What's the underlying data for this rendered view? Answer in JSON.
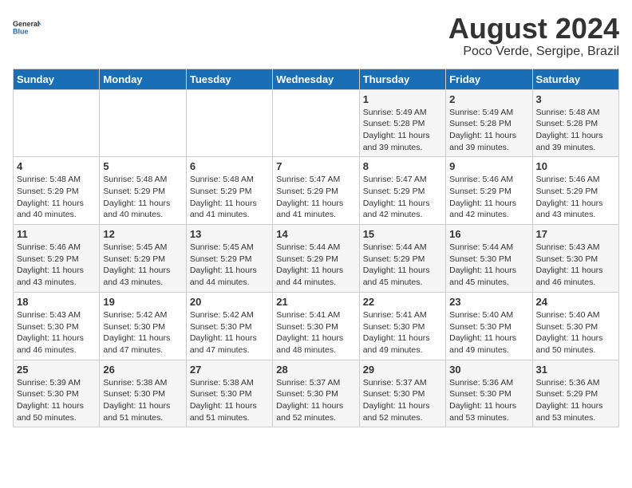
{
  "logo": {
    "line1": "General",
    "line2": "Blue"
  },
  "title": "August 2024",
  "subtitle": "Poco Verde, Sergipe, Brazil",
  "days_of_week": [
    "Sunday",
    "Monday",
    "Tuesday",
    "Wednesday",
    "Thursday",
    "Friday",
    "Saturday"
  ],
  "weeks": [
    [
      {
        "day": "",
        "info": ""
      },
      {
        "day": "",
        "info": ""
      },
      {
        "day": "",
        "info": ""
      },
      {
        "day": "",
        "info": ""
      },
      {
        "day": "1",
        "info": "Sunrise: 5:49 AM\nSunset: 5:28 PM\nDaylight: 11 hours\nand 39 minutes."
      },
      {
        "day": "2",
        "info": "Sunrise: 5:49 AM\nSunset: 5:28 PM\nDaylight: 11 hours\nand 39 minutes."
      },
      {
        "day": "3",
        "info": "Sunrise: 5:48 AM\nSunset: 5:28 PM\nDaylight: 11 hours\nand 39 minutes."
      }
    ],
    [
      {
        "day": "4",
        "info": "Sunrise: 5:48 AM\nSunset: 5:29 PM\nDaylight: 11 hours\nand 40 minutes."
      },
      {
        "day": "5",
        "info": "Sunrise: 5:48 AM\nSunset: 5:29 PM\nDaylight: 11 hours\nand 40 minutes."
      },
      {
        "day": "6",
        "info": "Sunrise: 5:48 AM\nSunset: 5:29 PM\nDaylight: 11 hours\nand 41 minutes."
      },
      {
        "day": "7",
        "info": "Sunrise: 5:47 AM\nSunset: 5:29 PM\nDaylight: 11 hours\nand 41 minutes."
      },
      {
        "day": "8",
        "info": "Sunrise: 5:47 AM\nSunset: 5:29 PM\nDaylight: 11 hours\nand 42 minutes."
      },
      {
        "day": "9",
        "info": "Sunrise: 5:46 AM\nSunset: 5:29 PM\nDaylight: 11 hours\nand 42 minutes."
      },
      {
        "day": "10",
        "info": "Sunrise: 5:46 AM\nSunset: 5:29 PM\nDaylight: 11 hours\nand 43 minutes."
      }
    ],
    [
      {
        "day": "11",
        "info": "Sunrise: 5:46 AM\nSunset: 5:29 PM\nDaylight: 11 hours\nand 43 minutes."
      },
      {
        "day": "12",
        "info": "Sunrise: 5:45 AM\nSunset: 5:29 PM\nDaylight: 11 hours\nand 43 minutes."
      },
      {
        "day": "13",
        "info": "Sunrise: 5:45 AM\nSunset: 5:29 PM\nDaylight: 11 hours\nand 44 minutes."
      },
      {
        "day": "14",
        "info": "Sunrise: 5:44 AM\nSunset: 5:29 PM\nDaylight: 11 hours\nand 44 minutes."
      },
      {
        "day": "15",
        "info": "Sunrise: 5:44 AM\nSunset: 5:29 PM\nDaylight: 11 hours\nand 45 minutes."
      },
      {
        "day": "16",
        "info": "Sunrise: 5:44 AM\nSunset: 5:30 PM\nDaylight: 11 hours\nand 45 minutes."
      },
      {
        "day": "17",
        "info": "Sunrise: 5:43 AM\nSunset: 5:30 PM\nDaylight: 11 hours\nand 46 minutes."
      }
    ],
    [
      {
        "day": "18",
        "info": "Sunrise: 5:43 AM\nSunset: 5:30 PM\nDaylight: 11 hours\nand 46 minutes."
      },
      {
        "day": "19",
        "info": "Sunrise: 5:42 AM\nSunset: 5:30 PM\nDaylight: 11 hours\nand 47 minutes."
      },
      {
        "day": "20",
        "info": "Sunrise: 5:42 AM\nSunset: 5:30 PM\nDaylight: 11 hours\nand 47 minutes."
      },
      {
        "day": "21",
        "info": "Sunrise: 5:41 AM\nSunset: 5:30 PM\nDaylight: 11 hours\nand 48 minutes."
      },
      {
        "day": "22",
        "info": "Sunrise: 5:41 AM\nSunset: 5:30 PM\nDaylight: 11 hours\nand 49 minutes."
      },
      {
        "day": "23",
        "info": "Sunrise: 5:40 AM\nSunset: 5:30 PM\nDaylight: 11 hours\nand 49 minutes."
      },
      {
        "day": "24",
        "info": "Sunrise: 5:40 AM\nSunset: 5:30 PM\nDaylight: 11 hours\nand 50 minutes."
      }
    ],
    [
      {
        "day": "25",
        "info": "Sunrise: 5:39 AM\nSunset: 5:30 PM\nDaylight: 11 hours\nand 50 minutes."
      },
      {
        "day": "26",
        "info": "Sunrise: 5:38 AM\nSunset: 5:30 PM\nDaylight: 11 hours\nand 51 minutes."
      },
      {
        "day": "27",
        "info": "Sunrise: 5:38 AM\nSunset: 5:30 PM\nDaylight: 11 hours\nand 51 minutes."
      },
      {
        "day": "28",
        "info": "Sunrise: 5:37 AM\nSunset: 5:30 PM\nDaylight: 11 hours\nand 52 minutes."
      },
      {
        "day": "29",
        "info": "Sunrise: 5:37 AM\nSunset: 5:30 PM\nDaylight: 11 hours\nand 52 minutes."
      },
      {
        "day": "30",
        "info": "Sunrise: 5:36 AM\nSunset: 5:30 PM\nDaylight: 11 hours\nand 53 minutes."
      },
      {
        "day": "31",
        "info": "Sunrise: 5:36 AM\nSunset: 5:29 PM\nDaylight: 11 hours\nand 53 minutes."
      }
    ]
  ]
}
